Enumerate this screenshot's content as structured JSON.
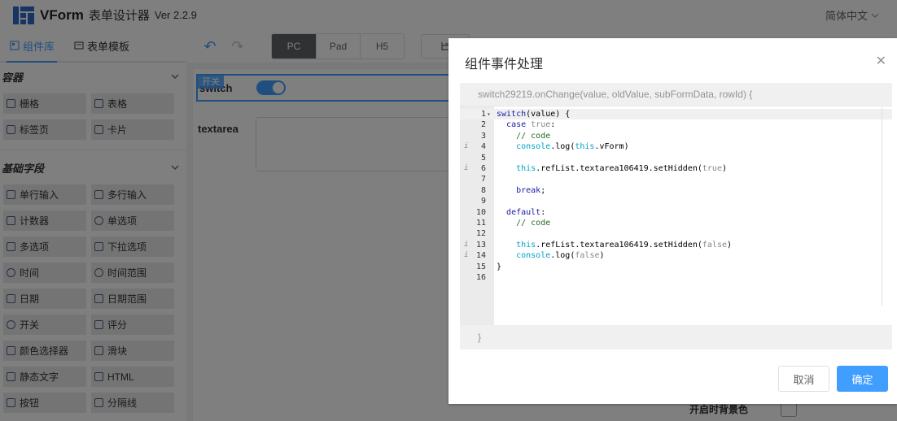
{
  "header": {
    "app_name": "VForm",
    "app_subtitle": "表单设计器",
    "version": "Ver 2.2.9",
    "language": "简体中文"
  },
  "left_panel": {
    "tabs": [
      {
        "label": "组件库",
        "icon": "component-icon",
        "active": true
      },
      {
        "label": "表单模板",
        "icon": "template-icon",
        "active": false
      }
    ],
    "sections": [
      {
        "title": "容器",
        "items": [
          {
            "label": "栅格",
            "icon": "grid-icon"
          },
          {
            "label": "表格",
            "icon": "table-icon"
          },
          {
            "label": "标签页",
            "icon": "tabs-icon"
          },
          {
            "label": "卡片",
            "icon": "card-icon"
          }
        ]
      },
      {
        "title": "基础字段",
        "items": [
          {
            "label": "单行输入",
            "icon": "input-icon"
          },
          {
            "label": "多行输入",
            "icon": "textarea-icon"
          },
          {
            "label": "计数器",
            "icon": "number-icon"
          },
          {
            "label": "单选项",
            "icon": "radio-icon"
          },
          {
            "label": "多选项",
            "icon": "checkbox-icon"
          },
          {
            "label": "下拉选项",
            "icon": "select-icon"
          },
          {
            "label": "时间",
            "icon": "time-icon"
          },
          {
            "label": "时间范围",
            "icon": "time-range-icon"
          },
          {
            "label": "日期",
            "icon": "date-icon"
          },
          {
            "label": "日期范围",
            "icon": "date-range-icon"
          },
          {
            "label": "开关",
            "icon": "switch-icon"
          },
          {
            "label": "评分",
            "icon": "rate-icon"
          },
          {
            "label": "颜色选择器",
            "icon": "color-picker-icon"
          },
          {
            "label": "滑块",
            "icon": "slider-icon"
          },
          {
            "label": "静态文字",
            "icon": "static-text-icon"
          },
          {
            "label": "HTML",
            "icon": "html-icon"
          },
          {
            "label": "按钮",
            "icon": "button-icon"
          },
          {
            "label": "分隔线",
            "icon": "divider-icon"
          }
        ]
      }
    ]
  },
  "toolbar": {
    "devices": [
      "PC",
      "Pad",
      "H5"
    ],
    "active_device": "PC"
  },
  "canvas": {
    "switch_label": "switch",
    "switch_tag": "开关",
    "textarea_label": "textarea"
  },
  "right_panel": {
    "visible_label": "开启时背景色"
  },
  "dialog": {
    "title": "组件事件处理",
    "function_header": "switch29219.onChange(value, oldValue, subFormData, rowId) {",
    "function_footer": "}",
    "cancel_label": "取消",
    "ok_label": "确定",
    "code_lines": [
      {
        "n": "1",
        "marker": "",
        "fold": "▾",
        "hl": true
      },
      {
        "n": "2",
        "marker": "",
        "fold": "",
        "hl": false
      },
      {
        "n": "3",
        "marker": "",
        "fold": "",
        "hl": false
      },
      {
        "n": "4",
        "marker": "i",
        "fold": "",
        "hl": false
      },
      {
        "n": "5",
        "marker": "",
        "fold": "",
        "hl": false
      },
      {
        "n": "6",
        "marker": "i",
        "fold": "",
        "hl": false
      },
      {
        "n": "7",
        "marker": "",
        "fold": "",
        "hl": false
      },
      {
        "n": "8",
        "marker": "",
        "fold": "",
        "hl": false
      },
      {
        "n": "9",
        "marker": "",
        "fold": "",
        "hl": false
      },
      {
        "n": "10",
        "marker": "",
        "fold": "",
        "hl": false
      },
      {
        "n": "11",
        "marker": "",
        "fold": "",
        "hl": false
      },
      {
        "n": "12",
        "marker": "",
        "fold": "",
        "hl": false
      },
      {
        "n": "13",
        "marker": "i",
        "fold": "",
        "hl": false
      },
      {
        "n": "14",
        "marker": "i",
        "fold": "",
        "hl": false
      },
      {
        "n": "15",
        "marker": "",
        "fold": "",
        "hl": false
      },
      {
        "n": "16",
        "marker": "",
        "fold": "",
        "hl": false
      }
    ],
    "code_tokens": [
      [
        [
          "kw",
          "switch"
        ],
        [
          "",
          "("
        ],
        [
          "",
          "value"
        ],
        [
          "",
          ") {"
        ]
      ],
      [
        [
          "",
          "  "
        ],
        [
          "kw",
          "case"
        ],
        [
          "gr",
          " true"
        ],
        [
          "",
          ":"
        ]
      ],
      [
        [
          "",
          "    "
        ],
        [
          "cm",
          "// code"
        ]
      ],
      [
        [
          "",
          "    "
        ],
        [
          "mt",
          "console"
        ],
        [
          "",
          ".log("
        ],
        [
          "mt",
          "this"
        ],
        [
          "",
          ".vForm)"
        ]
      ],
      [],
      [
        [
          "",
          "    "
        ],
        [
          "mt",
          "this"
        ],
        [
          "",
          ".refList.textarea106419.setHidden("
        ],
        [
          "gr",
          "true"
        ],
        [
          "",
          ")"
        ]
      ],
      [],
      [
        [
          "",
          "    "
        ],
        [
          "kw",
          "break"
        ],
        [
          "",
          ";"
        ]
      ],
      [],
      [
        [
          "",
          "  "
        ],
        [
          "kw",
          "default"
        ],
        [
          "",
          ":"
        ]
      ],
      [
        [
          "",
          "    "
        ],
        [
          "cm",
          "// code"
        ]
      ],
      [],
      [
        [
          "",
          "    "
        ],
        [
          "mt",
          "this"
        ],
        [
          "",
          ".refList.textarea106419.setHidden("
        ],
        [
          "gr",
          "false"
        ],
        [
          "",
          ")"
        ]
      ],
      [
        [
          "",
          "    "
        ],
        [
          "mt",
          "console"
        ],
        [
          "",
          ".log("
        ],
        [
          "gr",
          "false"
        ],
        [
          "",
          ")"
        ]
      ],
      [
        [
          "",
          "}"
        ]
      ],
      []
    ]
  }
}
